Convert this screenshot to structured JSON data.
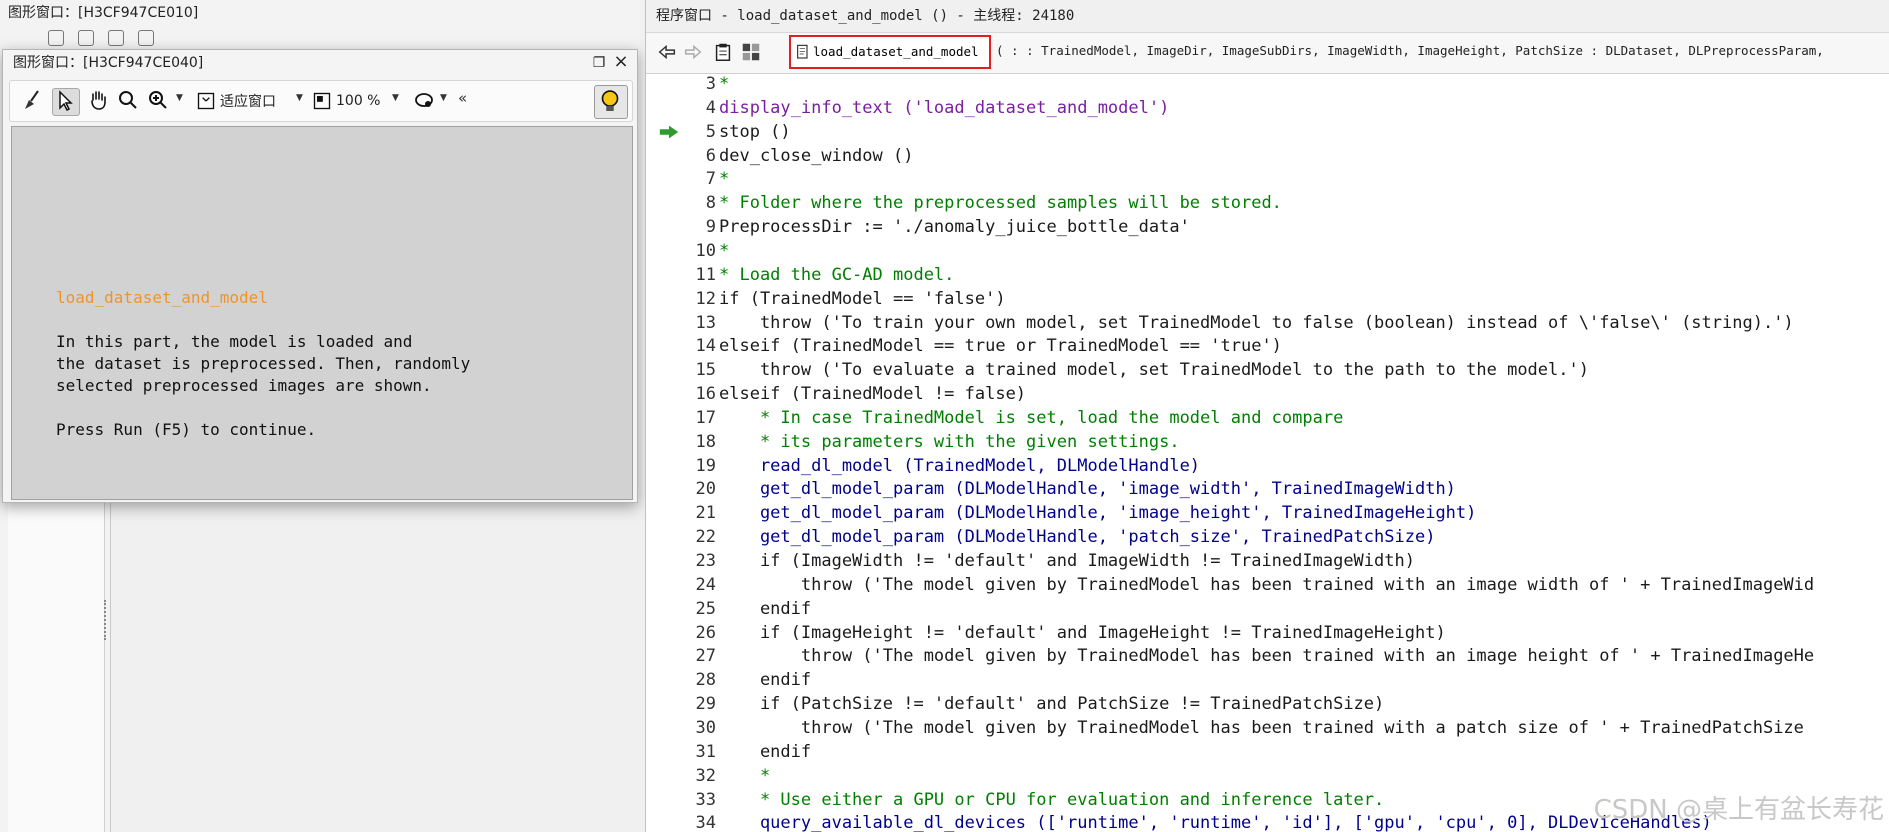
{
  "bg_window": {
    "title": "图形窗口：[H3CF947CE010]"
  },
  "float_window": {
    "title": "图形窗口：[H3CF947CE040]",
    "toolbar": {
      "fit_label": "适应窗口",
      "zoom_label": "100 %",
      "more": "«"
    },
    "info": {
      "heading": "load_dataset_and_model",
      "paragraph1": "In this part, the model is loaded and\nthe dataset is preprocessed. Then, randomly\nselected preprocessed images are shown.",
      "paragraph2": "Press Run (F5) to continue."
    }
  },
  "program_window": {
    "title": "程序窗口 - load_dataset_and_model () - 主线程: 24180",
    "procedure_name": "load_dataset_and_model",
    "procedure_signature": "( : : TrainedModel, ImageDir, ImageSubDirs, ImageWidth, ImageHeight, PatchSize : DLDataset, DLPreprocessParam,",
    "current_line": 5,
    "lines": [
      {
        "n": "3",
        "t": "*",
        "k": "c-comment"
      },
      {
        "n": "4",
        "t": "display_info_text ('load_dataset_and_model')",
        "k": "c-op"
      },
      {
        "n": "5",
        "t": "stop ()",
        "k": "c-plain"
      },
      {
        "n": "6",
        "t": "dev_close_window ()",
        "k": "c-plain"
      },
      {
        "n": "7",
        "t": "*",
        "k": "c-comment"
      },
      {
        "n": "8",
        "t": "* Folder where the preprocessed samples will be stored.",
        "k": "c-comment"
      },
      {
        "n": "9",
        "t": "PreprocessDir := './anomaly_juice_bottle_data'",
        "k": "c-plain"
      },
      {
        "n": "10",
        "t": "*",
        "k": "c-comment"
      },
      {
        "n": "11",
        "t": "* Load the GC-AD model.",
        "k": "c-comment"
      },
      {
        "n": "12",
        "t": "if (TrainedModel == 'false')",
        "k": "c-ctrl"
      },
      {
        "n": "13",
        "t": "    throw ('To train your own model, set TrainedModel to false (boolean) instead of \\'false\\' (string).')",
        "k": "c-ctrl"
      },
      {
        "n": "14",
        "t": "elseif (TrainedModel == true or TrainedModel == 'true')",
        "k": "c-ctrl"
      },
      {
        "n": "15",
        "t": "    throw ('To evaluate a trained model, set TrainedModel to the path to the model.')",
        "k": "c-ctrl"
      },
      {
        "n": "16",
        "t": "elseif (TrainedModel != false)",
        "k": "c-ctrl"
      },
      {
        "n": "17",
        "t": "    * In case TrainedModel is set, load the model and compare",
        "k": "c-comment"
      },
      {
        "n": "18",
        "t": "    * its parameters with the given settings.",
        "k": "c-comment"
      },
      {
        "n": "19",
        "t": "    read_dl_model (TrainedModel, DLModelHandle)",
        "k": "c-proc"
      },
      {
        "n": "20",
        "t": "    get_dl_model_param (DLModelHandle, 'image_width', TrainedImageWidth)",
        "k": "c-proc"
      },
      {
        "n": "21",
        "t": "    get_dl_model_param (DLModelHandle, 'image_height', TrainedImageHeight)",
        "k": "c-proc"
      },
      {
        "n": "22",
        "t": "    get_dl_model_param (DLModelHandle, 'patch_size', TrainedPatchSize)",
        "k": "c-proc"
      },
      {
        "n": "23",
        "t": "    if (ImageWidth != 'default' and ImageWidth != TrainedImageWidth)",
        "k": "c-ctrl"
      },
      {
        "n": "24",
        "t": "        throw ('The model given by TrainedModel has been trained with an image width of ' + TrainedImageWid",
        "k": "c-ctrl"
      },
      {
        "n": "25",
        "t": "    endif",
        "k": "c-ctrl"
      },
      {
        "n": "26",
        "t": "    if (ImageHeight != 'default' and ImageHeight != TrainedImageHeight)",
        "k": "c-ctrl"
      },
      {
        "n": "27",
        "t": "        throw ('The model given by TrainedModel has been trained with an image height of ' + TrainedImageHe",
        "k": "c-ctrl"
      },
      {
        "n": "28",
        "t": "    endif",
        "k": "c-ctrl"
      },
      {
        "n": "29",
        "t": "    if (PatchSize != 'default' and PatchSize != TrainedPatchSize)",
        "k": "c-ctrl"
      },
      {
        "n": "30",
        "t": "        throw ('The model given by TrainedModel has been trained with a patch size of ' + TrainedPatchSize ",
        "k": "c-ctrl"
      },
      {
        "n": "31",
        "t": "    endif",
        "k": "c-ctrl"
      },
      {
        "n": "32",
        "t": "    *",
        "k": "c-comment"
      },
      {
        "n": "33",
        "t": "    * Use either a GPU or CPU for evaluation and inference later.",
        "k": "c-comment"
      },
      {
        "n": "34",
        "t": "    query_available_dl_devices (['runtime', 'runtime', 'id'], ['gpu', 'cpu', 0], DLDeviceHandles)",
        "k": "c-proc"
      }
    ]
  },
  "watermark": "CSDN @桌上有盆长寿花",
  "colors": {
    "highlight_box": "#e02020",
    "info_heading": "#f0932b",
    "comment": "#008000",
    "operator": "#7a1fa2",
    "procedure": "#00008b"
  }
}
